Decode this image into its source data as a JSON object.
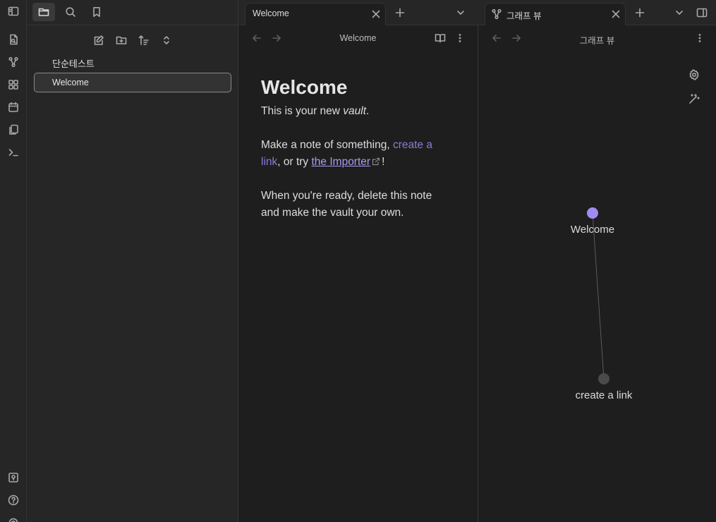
{
  "sidebar": {
    "tabs": [
      "files-tab",
      "search-tab",
      "bookmarks-tab"
    ],
    "folder_name": "단순테스트",
    "active_file": "Welcome"
  },
  "ribbon": {
    "icons": [
      "open-quick-switcher-icon",
      "graph-icon",
      "canvas-icon",
      "daily-note-icon",
      "templates-icon",
      "command-palette-icon",
      "vault-icon",
      "help-icon",
      "settings-icon"
    ]
  },
  "left_pane": {
    "tab_label": "Welcome",
    "title": "Welcome"
  },
  "right_pane": {
    "tab_label": "그래프 뷰",
    "title": "그래프 뷰"
  },
  "note": {
    "heading": "Welcome",
    "p1_before": "This is your new ",
    "p1_em": "vault",
    "p1_after": ".",
    "p2_before": "Make a note of something, ",
    "p2_link": "create a link",
    "p2_middle": ", or try ",
    "p2_ext_link": "the Importer",
    "p2_after": "!",
    "p3": "When you're ready, delete this note and make the vault your own."
  },
  "graph": {
    "nodes": [
      {
        "label": "Welcome",
        "active": true
      },
      {
        "label": "create a link",
        "active": false
      }
    ],
    "colors": {
      "active_node": "#a08cf0",
      "node": "#4a4a4a",
      "edge": "#5a5a5a"
    }
  }
}
